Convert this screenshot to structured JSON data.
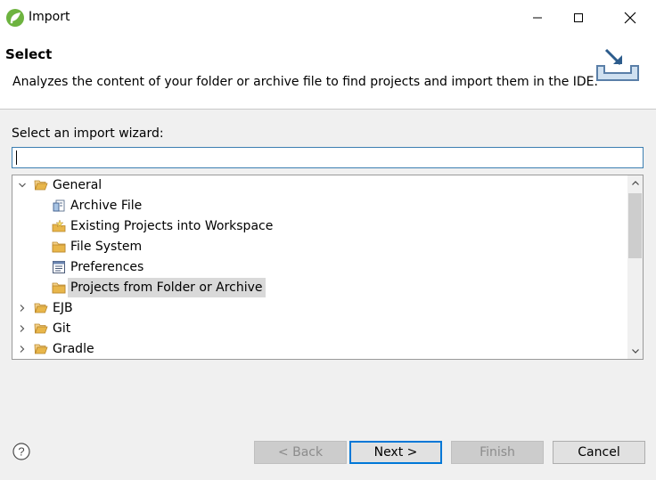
{
  "window": {
    "title": "Import"
  },
  "header": {
    "title": "Select",
    "description": "Analyzes the content of your folder or archive file to find projects and import them in the IDE."
  },
  "wizard": {
    "label": "Select an import wizard:",
    "filter_value": "",
    "tree": [
      {
        "label": "General",
        "expanded": true,
        "icon": "folder-open-icon"
      },
      {
        "label": "Archive File",
        "icon": "archive-file-icon"
      },
      {
        "label": "Existing Projects into Workspace",
        "icon": "existing-projects-icon"
      },
      {
        "label": "File System",
        "icon": "folder-icon"
      },
      {
        "label": "Preferences",
        "icon": "preferences-icon"
      },
      {
        "label": "Projects from Folder or Archive",
        "icon": "folder-icon",
        "selected": true
      },
      {
        "label": "EJB",
        "expanded": false,
        "icon": "folder-open-icon"
      },
      {
        "label": "Git",
        "expanded": false,
        "icon": "folder-open-icon"
      },
      {
        "label": "Gradle",
        "expanded": false,
        "icon": "folder-open-icon"
      }
    ]
  },
  "buttons": {
    "back": "< Back",
    "next": "Next >",
    "finish": "Finish",
    "cancel": "Cancel"
  },
  "colors": {
    "focus": "#0078d7",
    "folder": "#e8b64a"
  }
}
